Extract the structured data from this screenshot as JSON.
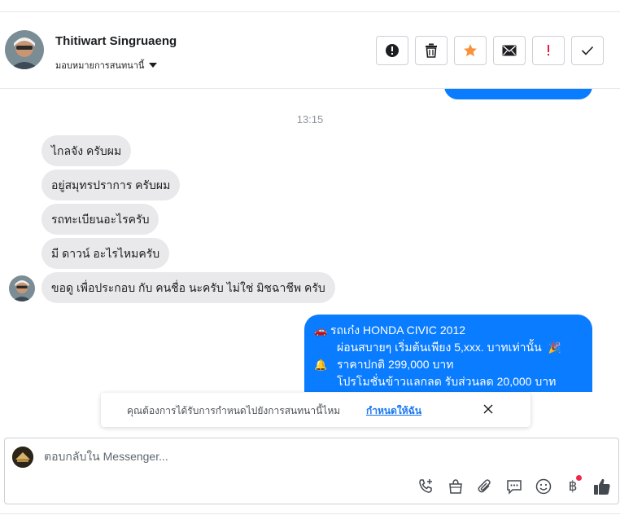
{
  "header": {
    "contact_name": "Thitiwart Singruaeng",
    "assign_label": "มอบหมายการสนทนานี้"
  },
  "actions": [
    {
      "icon": "alert-circle-icon",
      "label": "mark-spam"
    },
    {
      "icon": "trash-icon",
      "label": "delete"
    },
    {
      "icon": "star-icon",
      "label": "star",
      "color": "#f7923b"
    },
    {
      "icon": "envelope-icon",
      "label": "mark-unread"
    },
    {
      "icon": "exclamation-icon",
      "label": "follow-up",
      "color": "#e41e3f"
    },
    {
      "icon": "checkmark-icon",
      "label": "done"
    }
  ],
  "conversation": {
    "timestamp": "13:15",
    "incoming": [
      "ไกลจัง ครับผม",
      "อยู่สมุทรปราการ ครับผม",
      "รถทะเบียนอะไรครับ",
      "มี ดาวน์ อะไรไหมครับ",
      "ขอดู เพื่อประกอบ กับ คนชื่อ นะครับ ไม่ใช่ มิชฉาชีพ ครับ"
    ],
    "outgoing": {
      "line1": "รถเก๋ง HONDA CIVIC 2012",
      "line2": "ผ่อนสบายๆ เริ่มต้นเพียง 5,xxx. บาทเท่านั้น",
      "line3": "ราคาปกติ  299,000 บาท",
      "line4": "โปรโมชั่นข้าวแลกลด รับส่วนลด 20,000 บาท",
      "emoji1": "🚗",
      "emoji2": "🎉",
      "emoji3": "🔔"
    }
  },
  "notice": {
    "text": "คุณต้องการได้รับการกำหนดไปยังการสนทนานี้ไหม",
    "link": "กำหนดให้ฉัน"
  },
  "composer": {
    "placeholder": "ตอบกลับใน Messenger...",
    "tools": [
      "phone-add-icon",
      "shopping-bag-icon",
      "paperclip-icon",
      "saved-reply-icon",
      "emoji-icon",
      "baht-icon",
      "thumbs-up-icon"
    ],
    "baht_symbol": "฿"
  },
  "colors": {
    "messenger_blue": "#0a7cff",
    "incoming_gray": "#e9e9eb",
    "link_blue": "#1877f2"
  }
}
